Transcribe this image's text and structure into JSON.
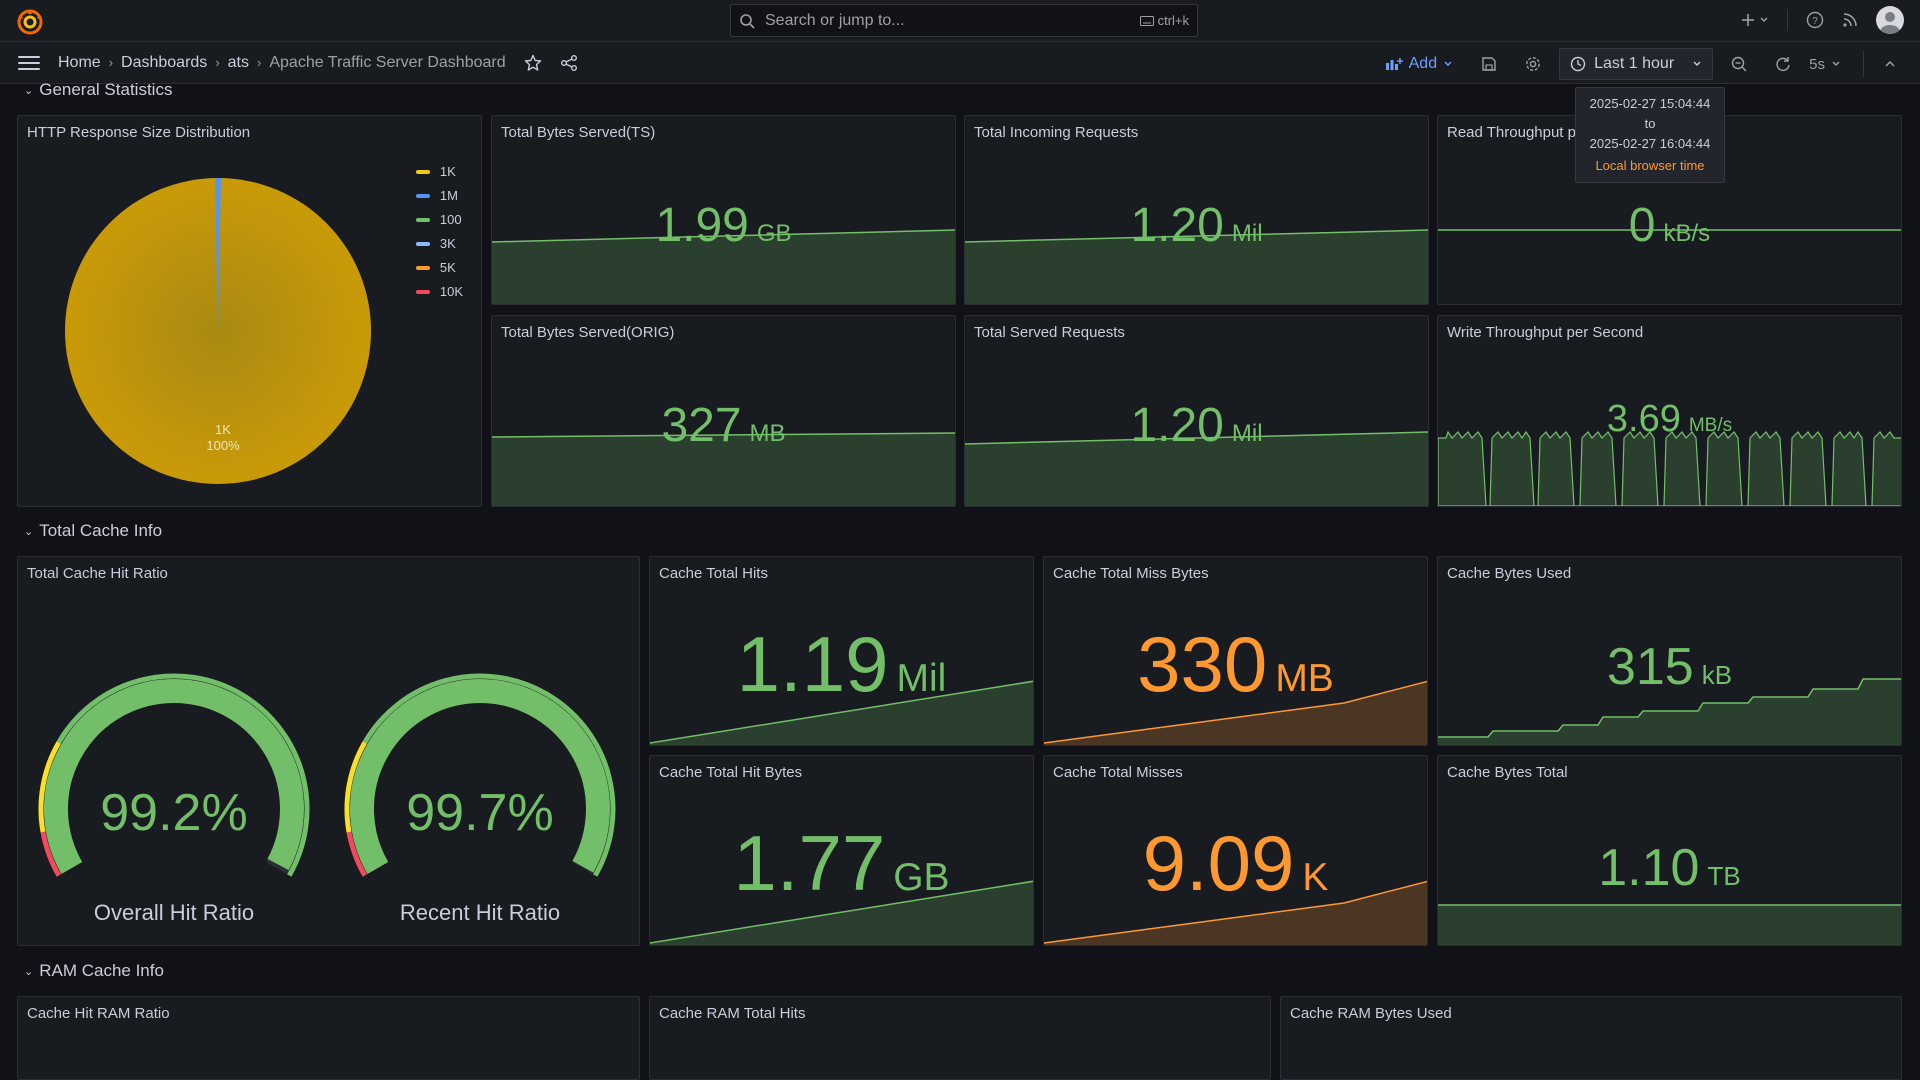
{
  "topbar": {
    "search_placeholder": "Search or jump to...",
    "search_shortcut": "ctrl+k"
  },
  "navbar": {
    "breadcrumbs": [
      "Home",
      "Dashboards",
      "ats",
      "Apache Traffic Server Dashboard"
    ],
    "add_label": "Add",
    "time_range": "Last 1 hour",
    "refresh_interval": "5s"
  },
  "tooltip": {
    "from": "2025-02-27 15:04:44",
    "to_word": "to",
    "to": "2025-02-27 16:04:44",
    "tz": "Local browser time"
  },
  "rows": {
    "general": "General Statistics",
    "cache": "Total Cache Info",
    "ram": "RAM Cache Info"
  },
  "panels": {
    "pie": {
      "title": "HTTP Response Size Distribution",
      "legend": [
        {
          "label": "1K",
          "color": "#f2cc0c"
        },
        {
          "label": "1M",
          "color": "#5794f2"
        },
        {
          "label": "100",
          "color": "#73bf69"
        },
        {
          "label": "3K",
          "color": "#8ab8ff"
        },
        {
          "label": "5K",
          "color": "#ff9830"
        },
        {
          "label": "10K",
          "color": "#f2495c"
        }
      ],
      "slice_label": "1K",
      "slice_percent": "100%"
    },
    "bytes_ts": {
      "title": "Total Bytes Served(TS)",
      "value": "1.99",
      "unit": "GB"
    },
    "incoming": {
      "title": "Total Incoming Requests",
      "value": "1.20",
      "unit": "Mil"
    },
    "read_tp": {
      "title": "Read Throughput per Second",
      "value": "0",
      "unit": "kB/s"
    },
    "bytes_orig": {
      "title": "Total Bytes Served(ORIG)",
      "value": "327",
      "unit": "MB"
    },
    "served": {
      "title": "Total Served Requests",
      "value": "1.20",
      "unit": "Mil"
    },
    "write_tp": {
      "title": "Write Throughput per Second",
      "value": "3.69",
      "unit": "MB/s"
    },
    "hit_ratio": {
      "title": "Total Cache Hit Ratio",
      "gauges": [
        {
          "value": "99.2%",
          "label": "Overall Hit Ratio",
          "fraction": 0.992
        },
        {
          "value": "99.7%",
          "label": "Recent Hit Ratio",
          "fraction": 0.997
        }
      ]
    },
    "hits": {
      "title": "Cache Total Hits",
      "value": "1.19",
      "unit": "Mil"
    },
    "miss_bytes": {
      "title": "Cache Total Miss Bytes",
      "value": "330",
      "unit": "MB"
    },
    "bytes_used": {
      "title": "Cache Bytes Used",
      "value": "315",
      "unit": "kB"
    },
    "hit_bytes": {
      "title": "Cache Total Hit Bytes",
      "value": "1.77",
      "unit": "GB"
    },
    "misses": {
      "title": "Cache Total Misses",
      "value": "9.09",
      "unit": "K"
    },
    "bytes_total": {
      "title": "Cache Bytes Total",
      "value": "1.10",
      "unit": "TB"
    },
    "ram_ratio": {
      "title": "Cache Hit RAM Ratio"
    },
    "ram_hits": {
      "title": "Cache RAM Total Hits"
    },
    "ram_used": {
      "title": "Cache RAM Bytes Used"
    }
  },
  "colors": {
    "green": "#73bf69",
    "orange": "#ff9830",
    "pie_yellow": "#c99a08",
    "accent": "#6e9fff"
  }
}
